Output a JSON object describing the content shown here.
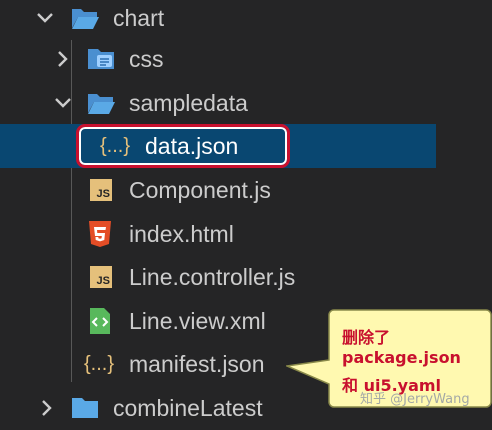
{
  "tree": {
    "chart": "chart",
    "css": "css",
    "sampledata": "sampledata",
    "data_json": "data.json",
    "component": "Component.js",
    "index": "index.html",
    "line_controller": "Line.controller.js",
    "line_view": "Line.view.xml",
    "manifest": "manifest.json",
    "combine": "combineLatest",
    "json_icon_text": "{...}",
    "js_badge": "JS"
  },
  "callout": {
    "line1": "删除了",
    "line2": "package.json",
    "line3": "和  ui5.yaml"
  },
  "watermark": "知乎 @JerryWang",
  "colors": {
    "background": "#252526",
    "selection": "#094771",
    "highlight_border": "#c8102e",
    "callout_fill": "#fff9b0",
    "folder": "#5aa9e6",
    "js": "#e5c07b",
    "html": "#e44d26",
    "xml": "#58b85c"
  }
}
